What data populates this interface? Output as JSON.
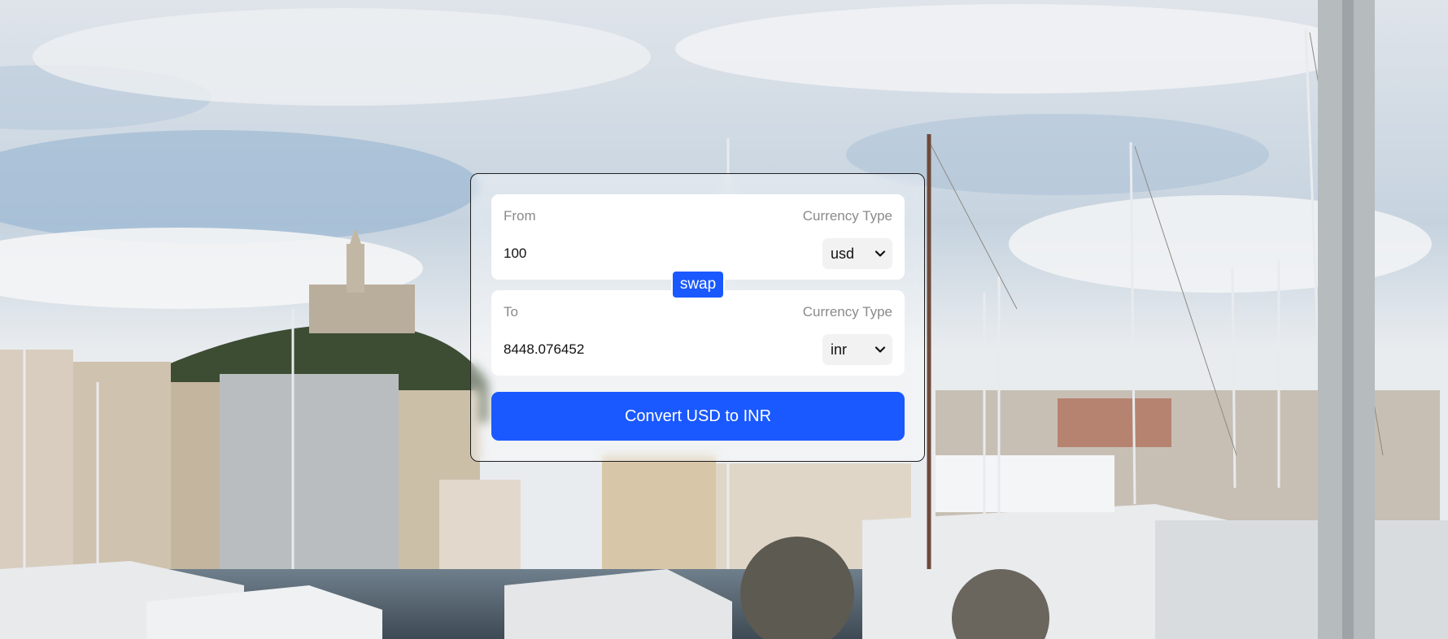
{
  "from": {
    "label": "From",
    "currency_type_label": "Currency Type",
    "amount": "100",
    "currency": "usd"
  },
  "swap_label": "swap",
  "to": {
    "label": "To",
    "currency_type_label": "Currency Type",
    "amount": "8448.076452",
    "currency": "inr"
  },
  "convert_label": "Convert USD to INR",
  "icons": {
    "dropdown": "chevron-down-icon"
  },
  "colors": {
    "accent": "#1a59ff"
  }
}
